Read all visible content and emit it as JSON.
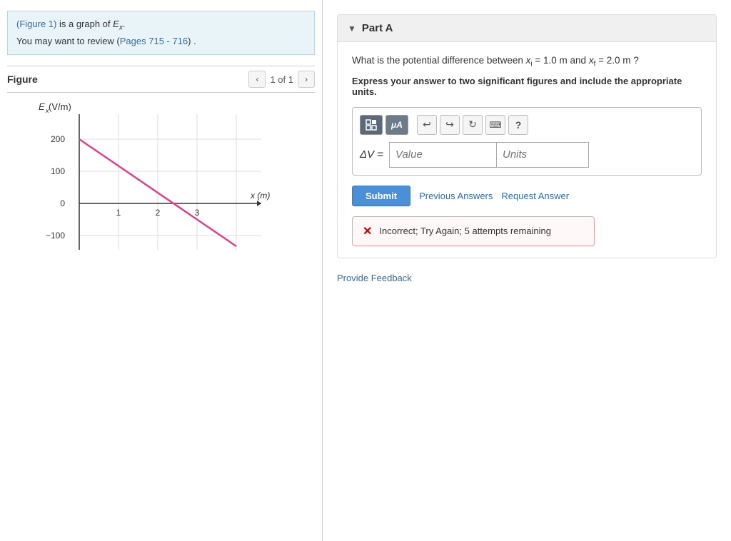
{
  "left": {
    "info_line1": "(Figure 1) is a graph of ",
    "info_link1_text": "Figure 1",
    "info_math": "Ex.",
    "info_line2": "You may want to review (",
    "info_link2_text": "Pages 715 - 716",
    "info_line2_end": ") .",
    "figure_title": "Figure",
    "figure_nav_count": "1 of 1"
  },
  "graph": {
    "y_label": "Ex (V/m)",
    "x_label": "x (m)",
    "y_values": [
      "200",
      "100",
      "0",
      "-100"
    ],
    "x_values": [
      "1",
      "2",
      "3"
    ]
  },
  "right": {
    "part_label": "Part A",
    "question": "What is the potential difference between xi = 1.0 m and xf = 2.0 m ?",
    "instruction": "Express your answer to two significant figures and include the appropriate units.",
    "toolbar": {
      "matrix_btn": "⊞",
      "mu_btn": "μA",
      "undo_btn": "↩",
      "redo_btn": "↪",
      "refresh_btn": "↺",
      "keyboard_btn": "⌨",
      "help_btn": "?"
    },
    "delta_v_label": "ΔV =",
    "value_placeholder": "Value",
    "units_placeholder": "Units",
    "submit_label": "Submit",
    "previous_answers_label": "Previous Answers",
    "request_answer_label": "Request Answer",
    "error_message": "Incorrect; Try Again; 5 attempts remaining",
    "feedback_label": "Provide Feedback"
  }
}
